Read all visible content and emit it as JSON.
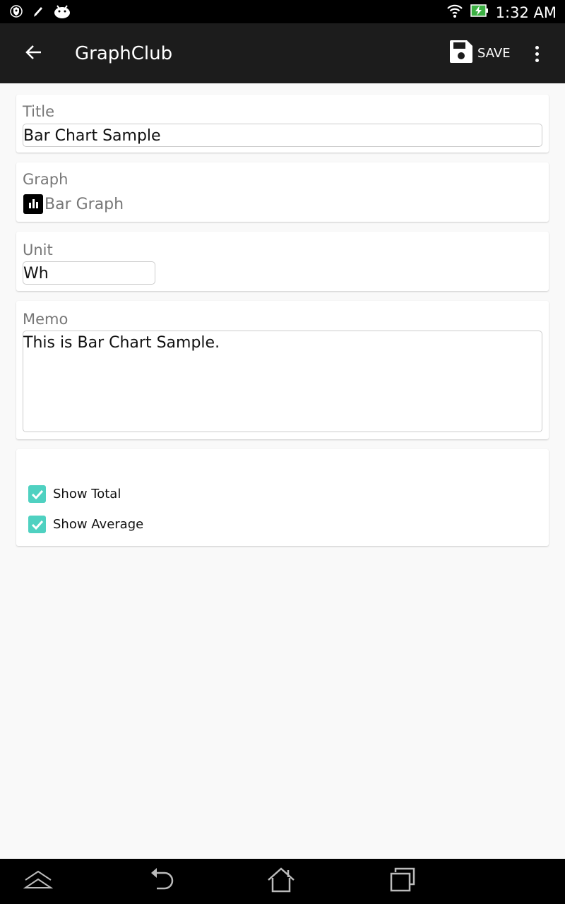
{
  "status_bar": {
    "icons_left": [
      "shield-icon",
      "pencil-icon",
      "android-icon"
    ],
    "icons_right": [
      "wifi-icon",
      "battery-charging-icon"
    ],
    "time": "1:32 AM"
  },
  "app_bar": {
    "title": "GraphClub",
    "back_icon": "arrow-left-icon",
    "save_label": "SAVE",
    "save_icon": "floppy-disk-icon",
    "overflow_icon": "more-vert-icon"
  },
  "form": {
    "title": {
      "label": "Title",
      "value": "Bar Chart Sample"
    },
    "graph": {
      "label": "Graph",
      "value": "Bar Graph",
      "icon": "bar-chart-icon"
    },
    "unit": {
      "label": "Unit",
      "value": "Wh"
    },
    "memo": {
      "label": "Memo",
      "value": "This is Bar Chart Sample."
    },
    "options": [
      {
        "label": "Show Total",
        "checked": true
      },
      {
        "label": "Show Average",
        "checked": true
      }
    ]
  },
  "colors": {
    "accent": "#4fd1c1",
    "app_bar": "#1c1c1c",
    "background": "#f9f9f9"
  },
  "nav_bar": {
    "buttons": [
      "collapse-icon",
      "back-icon",
      "home-icon",
      "recent-apps-icon"
    ]
  }
}
